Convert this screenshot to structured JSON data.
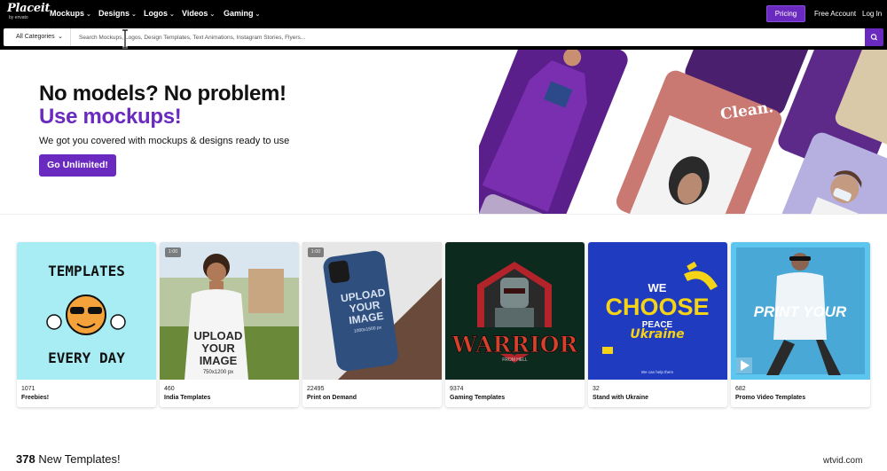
{
  "nav": {
    "logo_main": "Placeit",
    "logo_sub": "by envato",
    "menu": [
      {
        "label": "Mockups"
      },
      {
        "label": "Designs"
      },
      {
        "label": "Logos"
      },
      {
        "label": "Videos"
      },
      {
        "label": "Gaming"
      }
    ],
    "pricing_label": "Pricing",
    "free_account_label": "Free Account",
    "login_label": "Log In"
  },
  "search": {
    "category_label": "All Categories",
    "placeholder": "Search Mockups, Logos, Design Templates, Text Animations, Instagram Stories, Flyers..."
  },
  "hero": {
    "title_line1": "No models? No problem!",
    "title_line2": "Use mockups!",
    "subtitle": "We got you covered with mockups & designs ready to use",
    "cta_label": "Go Unlimited!",
    "collage_clean_text": "Clean."
  },
  "cards": [
    {
      "count": "1071",
      "label": "Freebies!",
      "art_line1": "TEMPLATES",
      "art_line2": "EVERY DAY",
      "bg": "#a8ecf4"
    },
    {
      "count": "460",
      "label": "India Templates",
      "badge": "1:00",
      "art_line1": "UPLOAD",
      "art_line2": "YOUR",
      "art_line3": "IMAGE",
      "art_line4": "750x1200 px"
    },
    {
      "count": "22495",
      "label": "Print on Demand",
      "badge": "1:00",
      "art_line1": "UPLOAD",
      "art_line2": "YOUR",
      "art_line3": "IMAGE",
      "art_line4": "1000x1500 px"
    },
    {
      "count": "9374",
      "label": "Gaming Templates",
      "art_line1": "WARRIOR",
      "art_line2": "FROM HELL",
      "bg": "#0d2a1e"
    },
    {
      "count": "32",
      "label": "Stand with Ukraine",
      "art_line1": "WE",
      "art_line2": "CHOOSE",
      "art_line3": "PEACE",
      "art_line4": "Ukraine",
      "art_line5": "We can help them",
      "bg": "#1f3bc0"
    },
    {
      "count": "682",
      "label": "Promo Video Templates",
      "art_line1": "PRINT YOUR",
      "bg": "#5cc6ee"
    }
  ],
  "new_templates": {
    "count": "378",
    "label": "New Templates!"
  },
  "watermark": "wtvid.com",
  "colors": {
    "brand_purple": "#6a2ac0",
    "topbar": "#000000"
  }
}
